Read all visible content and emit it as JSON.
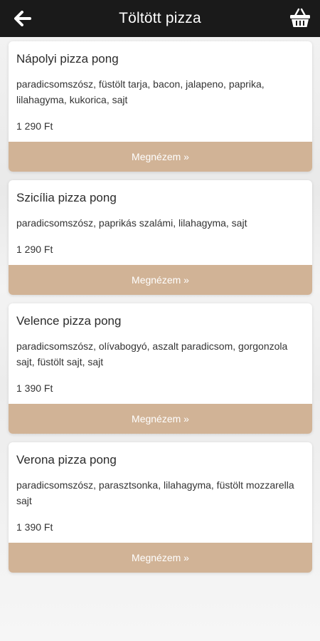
{
  "header": {
    "title": "Töltött pizza",
    "back_icon": "back-arrow-icon",
    "cart_icon": "basket-icon"
  },
  "colors": {
    "header_bg": "#1a1a1a",
    "button_bg": "#d1b396",
    "card_bg": "#ffffff"
  },
  "products": [
    {
      "name": "Nápolyi pizza pong",
      "description": "paradicsomszósz, füstölt tarja, bacon, jalapeno, paprika, lilahagyma, kukorica, sajt",
      "price": "1 290 Ft",
      "button_label": "Megnézem »"
    },
    {
      "name": "Szicília pizza pong",
      "description": "paradicsomszósz, paprikás szalámi, lilahagyma, sajt",
      "price": "1 290 Ft",
      "button_label": "Megnézem »"
    },
    {
      "name": "Velence pizza pong",
      "description": "paradicsomszósz, olívabogyó, aszalt paradicsom, gorgonzola sajt, füstölt sajt, sajt",
      "price": "1 390 Ft",
      "button_label": "Megnézem »"
    },
    {
      "name": "Verona pizza pong",
      "description": "paradicsomszósz, parasztsonka, lilahagyma, füstölt mozzarella sajt",
      "price": "1 390 Ft",
      "button_label": "Megnézem »"
    }
  ]
}
